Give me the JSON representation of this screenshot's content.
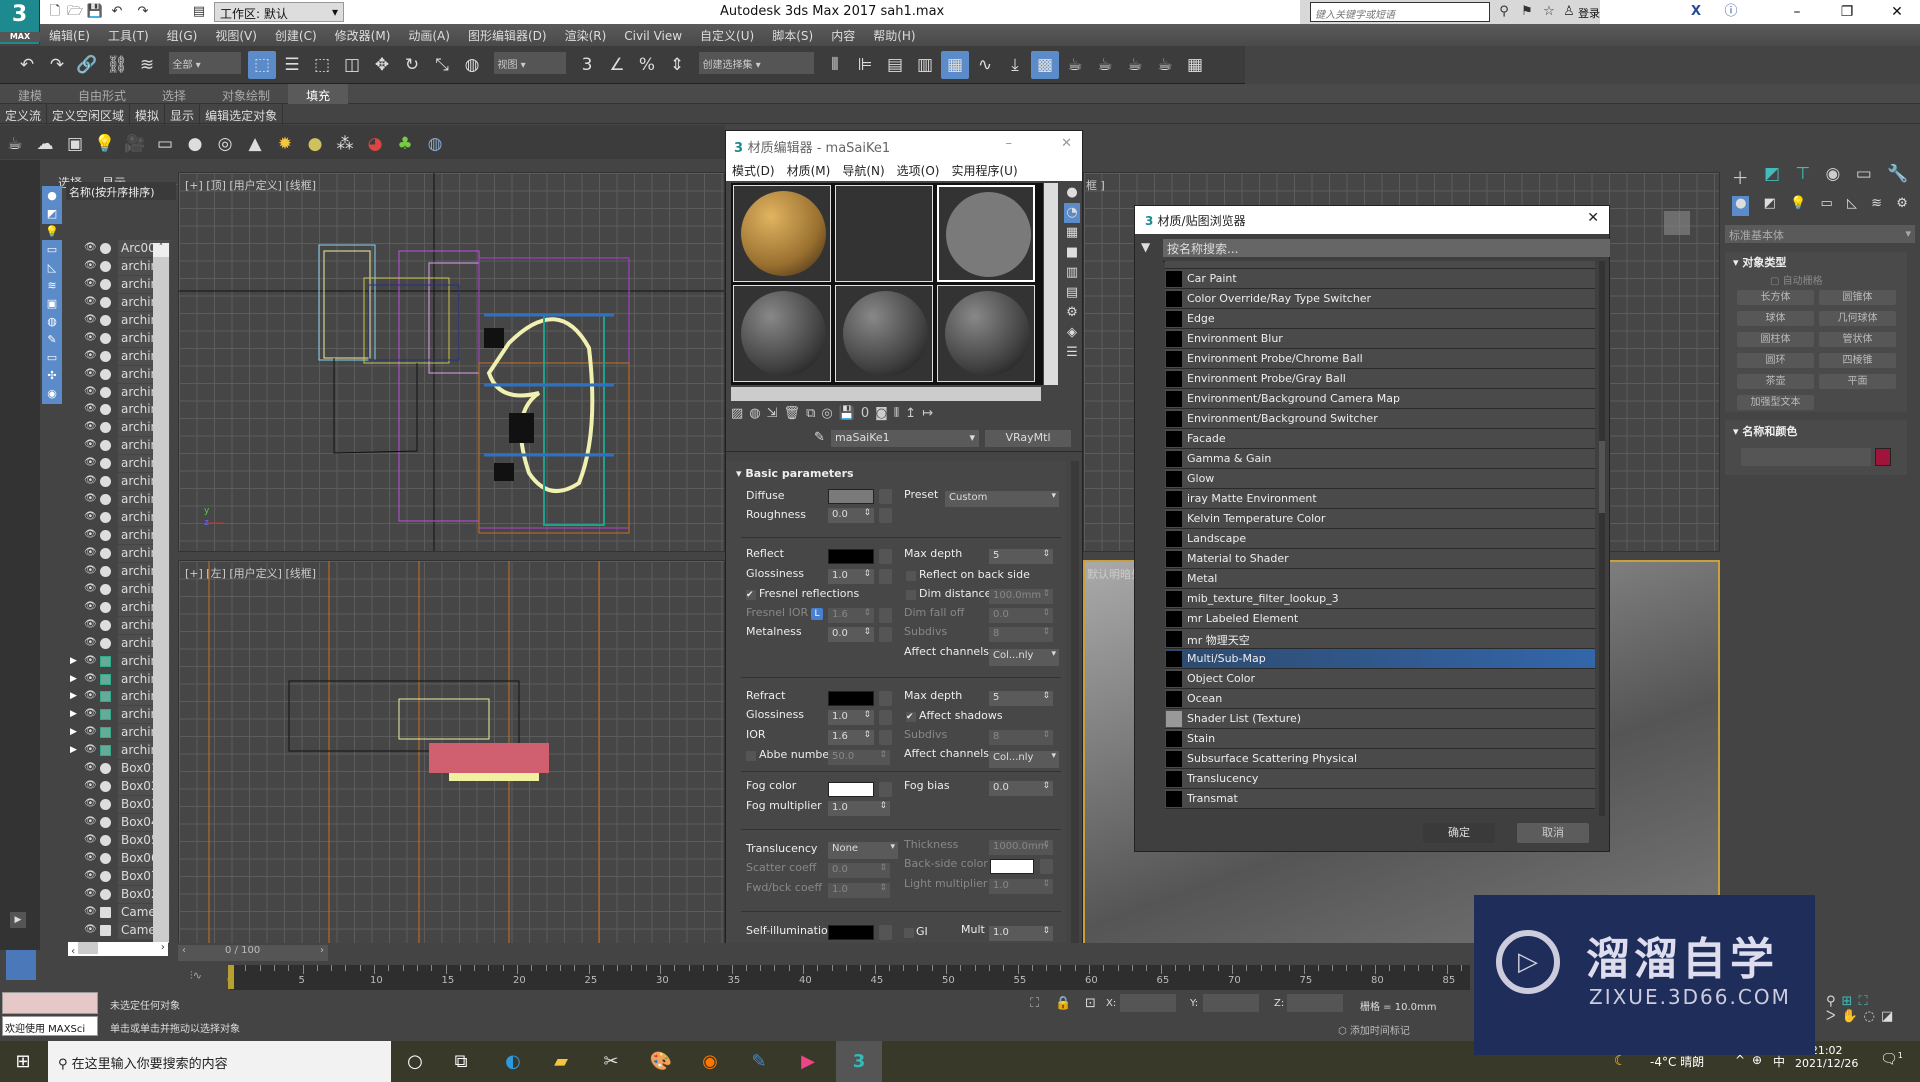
{
  "titlebar": {
    "workspace": "工作区: 默认",
    "app_title": "Autodesk 3ds Max 2017     sah1.max",
    "search_placeholder": "键入关键字或短语",
    "login": "登录",
    "logo": "3",
    "logo_sub": "MAX"
  },
  "menubar": [
    "编辑(E)",
    "工具(T)",
    "组(G)",
    "视图(V)",
    "创建(C)",
    "修改器(M)",
    "动画(A)",
    "图形编辑器(D)",
    "渲染(R)",
    "Civil View",
    "自定义(U)",
    "脚本(S)",
    "内容",
    "帮助(H)"
  ],
  "main_toolbar": {
    "filter": "全部",
    "ref_coord": "视图",
    "selection_set": "创建选择集",
    "icons": [
      "undo-icon",
      "redo-icon",
      "link-icon",
      "unlink-icon",
      "bind-space-warp-icon"
    ],
    "icons2": [
      "select-object-icon",
      "select-by-name-icon",
      "rect-selection-icon",
      "window-crossing-icon",
      "move-icon",
      "rotate-icon",
      "scale-icon",
      "placement-icon"
    ],
    "icons3": [
      "mirror-icon",
      "align-icon",
      "layer-icon",
      "scene-explorer-icon",
      "graphite-icon",
      "curve-editor-icon",
      "schematic-icon",
      "material-editor-icon",
      "render-setup-icon",
      "rendered-frame-icon",
      "render-icon",
      "render-cloud-icon",
      "a360-icon"
    ]
  },
  "ribbon": {
    "tabs": [
      "建模",
      "自由形式",
      "选择",
      "对象绘制",
      "填充"
    ],
    "active_tab": "填充",
    "subtabs": [
      "定义流",
      "定义空闲区域",
      "模拟",
      "显示",
      "编辑选定对象"
    ]
  },
  "explorer": {
    "tab_select": "选择",
    "tab_display": "显示",
    "column_header": "名称(按升序排序)",
    "items": [
      {
        "name": "Arc00",
        "type": "shape"
      },
      {
        "name": "archin"
      },
      {
        "name": "archin"
      },
      {
        "name": "archin"
      },
      {
        "name": "archin"
      },
      {
        "name": "archin"
      },
      {
        "name": "archin"
      },
      {
        "name": "archin"
      },
      {
        "name": "archin"
      },
      {
        "name": "archin"
      },
      {
        "name": "archin"
      },
      {
        "name": "archin"
      },
      {
        "name": "archin"
      },
      {
        "name": "archin"
      },
      {
        "name": "archin"
      },
      {
        "name": "archin"
      },
      {
        "name": "archin"
      },
      {
        "name": "archin"
      },
      {
        "name": "archin"
      },
      {
        "name": "archin"
      },
      {
        "name": "archin"
      },
      {
        "name": "archin"
      },
      {
        "name": "archin"
      },
      {
        "name": "archin",
        "expandable": true
      },
      {
        "name": "archin",
        "expandable": true
      },
      {
        "name": "archin",
        "expandable": true
      },
      {
        "name": "archin",
        "expandable": true
      },
      {
        "name": "archin",
        "expandable": true
      },
      {
        "name": "archin",
        "expandable": true
      },
      {
        "name": "Box01"
      },
      {
        "name": "Box02"
      },
      {
        "name": "Box03"
      },
      {
        "name": "Box04"
      },
      {
        "name": "Box05"
      },
      {
        "name": "Box06"
      },
      {
        "name": "Box07"
      },
      {
        "name": "Box02"
      },
      {
        "name": "Came",
        "type": "camera"
      },
      {
        "name": "Came",
        "type": "camera"
      }
    ]
  },
  "viewports": {
    "top": "[+] [顶] [用户定义] [线框]",
    "left": "[+] [左] [用户定义] [线框]",
    "top_right_partial": "框 ]",
    "persp_partial": "默认明暗处"
  },
  "mat_editor": {
    "title": "材质编辑器 - maSaiKe1",
    "menu": [
      "模式(D)",
      "材质(M)",
      "导航(N)",
      "选项(O)",
      "实用程序(U)"
    ],
    "material_name": "maSaiKe1",
    "material_type": "VRayMtl",
    "section": "Basic parameters",
    "p": {
      "diffuse": "Diffuse",
      "roughness": "Roughness",
      "roughness_v": "0.0",
      "preset": "Preset",
      "preset_v": "Custom",
      "reflect": "Reflect",
      "max_depth": "Max depth",
      "max_depth_v": "5",
      "gloss": "Glossiness",
      "gloss_v": "1.0",
      "back_side": "Reflect on back side",
      "fresnel": "Fresnel reflections",
      "dim_distance": "Dim distance",
      "dim_distance_v": "100.0mm",
      "fresnel_ior": "Fresnel IOR",
      "lock": "L",
      "fresnel_ior_v": "1.6",
      "dim_falloff": "Dim fall off",
      "dim_falloff_v": "0.0",
      "metalness": "Metalness",
      "metalness_v": "0.0",
      "subdivs": "Subdivs",
      "subdivs_v": "8",
      "affect_channels": "Affect channels",
      "affect_channels_v": "Col...nly",
      "refract": "Refract",
      "r_max_depth_v": "5",
      "r_gloss_v": "1.0",
      "affect_shadows": "Affect shadows",
      "ior": "IOR",
      "ior_v": "1.6",
      "abbe": "Abbe number",
      "abbe_v": "50.0",
      "fog_color": "Fog color",
      "fog_bias": "Fog bias",
      "fog_bias_v": "0.0",
      "fog_mult": "Fog multiplier",
      "fog_mult_v": "1.0",
      "translucency": "Translucency",
      "translucency_v": "None",
      "thickness": "Thickness",
      "thickness_v": "1000.0mm",
      "scatter": "Scatter coeff",
      "scatter_v": "0.0",
      "backside": "Back-side color",
      "fwd": "Fwd/bck coeff",
      "fwd_v": "1.0",
      "light_mult": "Light multiplier",
      "light_mult_v": "1.0",
      "self_illum": "Self-illumination",
      "gi": "GI",
      "mult": "Mult",
      "mult_v": "1.0"
    }
  },
  "browser": {
    "title": "材质/贴图浏览器",
    "search_placeholder": "按名称搜索...",
    "items": [
      "Car Paint",
      "Color Override/Ray Type Switcher",
      "Edge",
      "Environment Blur",
      "Environment Probe/Chrome Ball",
      "Environment Probe/Gray Ball",
      "Environment/Background Camera Map",
      "Environment/Background Switcher",
      "Facade",
      "Gamma & Gain",
      "Glow",
      "iray Matte Environment",
      "Kelvin Temperature Color",
      "Landscape",
      "Material to Shader",
      "Metal",
      "mib_texture_filter_lookup_3",
      "mr Labeled Element",
      "mr 物理天空",
      "Multi/Sub-Map",
      "Object Color",
      "Ocean",
      "Shader List (Texture)",
      "Stain",
      "Subsurface Scattering Physical",
      "Translucency",
      "Transmat"
    ],
    "selected": "Multi/Sub-Map",
    "ok": "确定",
    "cancel": "取消"
  },
  "command_panel": {
    "category": "标准基本体",
    "rollout_object_type": "对象类型",
    "autogrid": "自动栅格",
    "buttons": [
      "长方体",
      "圆锥体",
      "球体",
      "几何球体",
      "圆柱体",
      "管状体",
      "圆环",
      "四棱锥",
      "茶壶",
      "平面",
      "加强型文本"
    ],
    "rollout_name_color": "名称和颜色",
    "object_color": "#a0143c"
  },
  "timeline": {
    "frame": "0 / 100",
    "ticks": [
      "0",
      "5",
      "10",
      "15",
      "20",
      "25",
      "30",
      "35",
      "40",
      "45",
      "50",
      "55",
      "60",
      "65",
      "70",
      "75",
      "80",
      "85"
    ]
  },
  "status": {
    "line1": "未选定任何对象",
    "line2": "单击或单击并拖动以选择对象",
    "maxscript": "欢迎使用 MAXSci",
    "x_label": "X:",
    "y_label": "Y:",
    "z_label": "Z:",
    "grid": "栅格 = 10.0mm",
    "add_time_tag": "添加时间标记"
  },
  "taskbar": {
    "search_placeholder": "在这里输入你要搜索的内容",
    "weather": "-4°C 晴朗",
    "ime": "中",
    "time": "21:02",
    "date": "2021/12/26",
    "notifications": "1"
  },
  "watermark": {
    "brand": "溜溜自学",
    "url": "ZIXUE.3D66.COM"
  }
}
